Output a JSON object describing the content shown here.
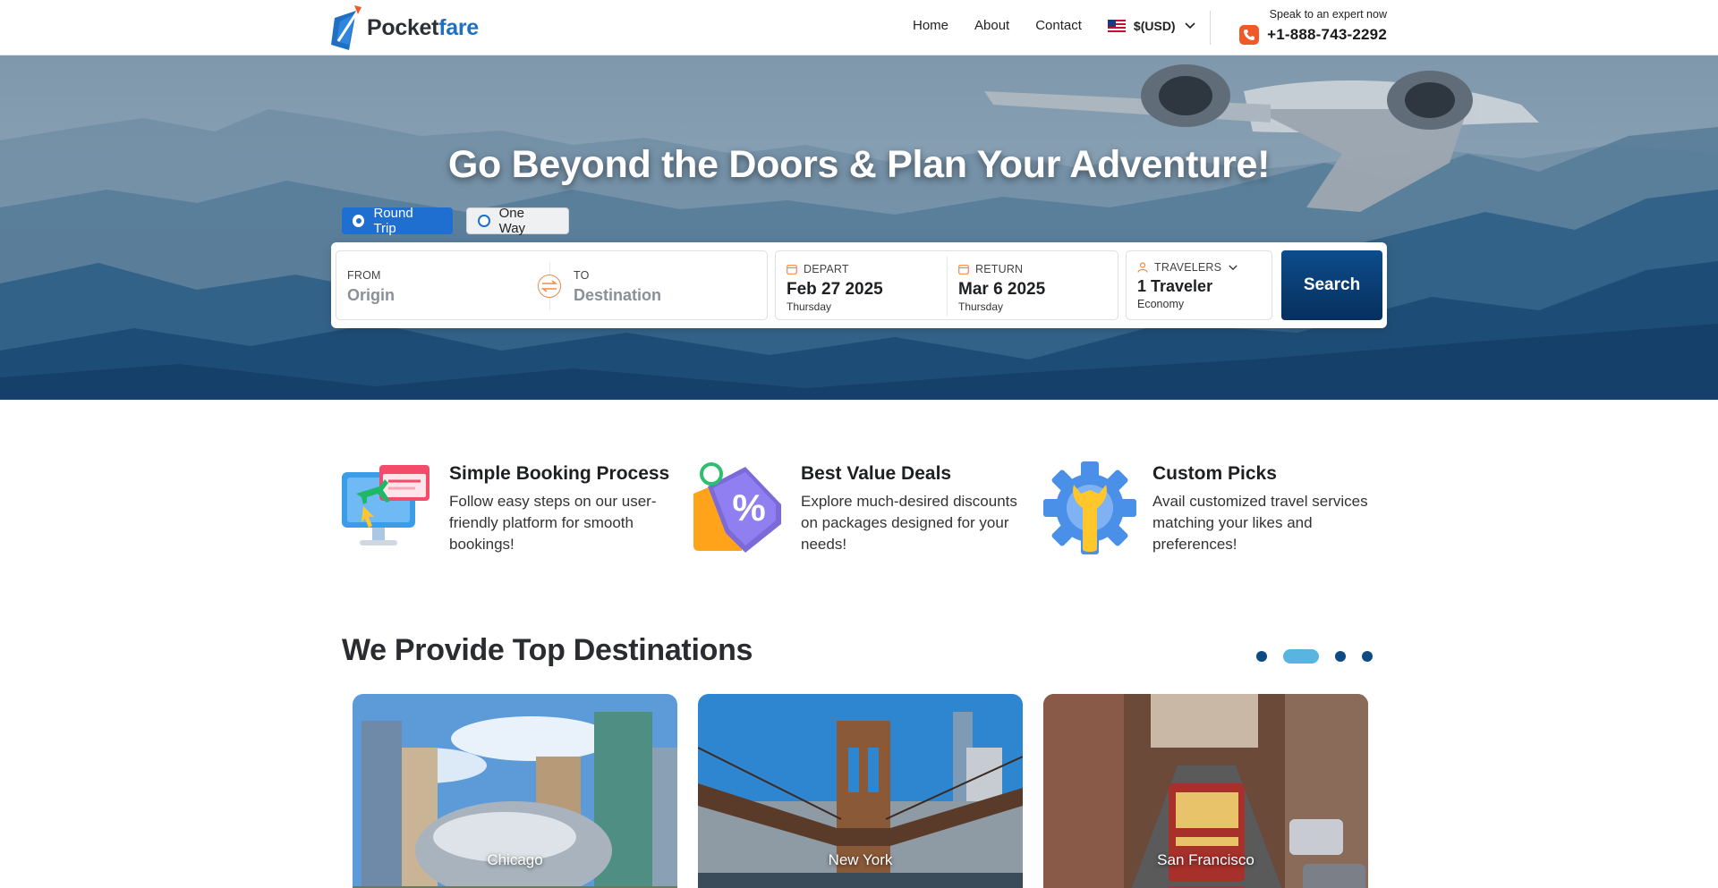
{
  "header": {
    "logo": {
      "part1": "Pocket",
      "part2": "fare"
    },
    "nav": [
      "Home",
      "About",
      "Contact"
    ],
    "currency": "$(USD)",
    "expert_label": "Speak to an expert now",
    "phone": "+1-888-743-2292"
  },
  "hero": {
    "title": "Go Beyond the Doors & Plan Your Adventure!",
    "trip_types": {
      "round": "Round Trip",
      "one": "One Way",
      "selected": "Round Trip"
    },
    "from": {
      "label": "FROM",
      "placeholder": "Origin"
    },
    "to": {
      "label": "TO",
      "placeholder": "Destination"
    },
    "depart": {
      "label": "DEPART",
      "date": "Feb 27 2025",
      "day": "Thursday"
    },
    "return": {
      "label": "RETURN",
      "date": "Mar 6 2025",
      "day": "Thursday"
    },
    "travelers": {
      "label": "TRAVELERS",
      "value": "1 Traveler",
      "class": "Economy"
    },
    "search_label": "Search"
  },
  "features": [
    {
      "title": "Simple Booking Process",
      "desc": "Follow easy steps on our user-friendly platform for smooth bookings!",
      "icon": "booking-monitor-icon"
    },
    {
      "title": "Best Value Deals",
      "desc": "Explore much-desired discounts on packages designed for your needs!",
      "icon": "discount-tag-icon"
    },
    {
      "title": "Custom Picks",
      "desc": "Avail customized travel services matching your likes and preferences!",
      "icon": "wrench-gear-icon"
    }
  ],
  "destinations": {
    "heading": "We Provide Top Destinations",
    "carousel": {
      "pages": 4,
      "active": 2
    },
    "cards": [
      {
        "name": "Chicago"
      },
      {
        "name": "New York"
      },
      {
        "name": "San Francisco"
      }
    ]
  },
  "colors": {
    "brand_blue": "#1f6fc2",
    "search_button": "#0d4c8c",
    "accent_orange": "#f05a28",
    "carousel_active": "#5ab4e0"
  }
}
